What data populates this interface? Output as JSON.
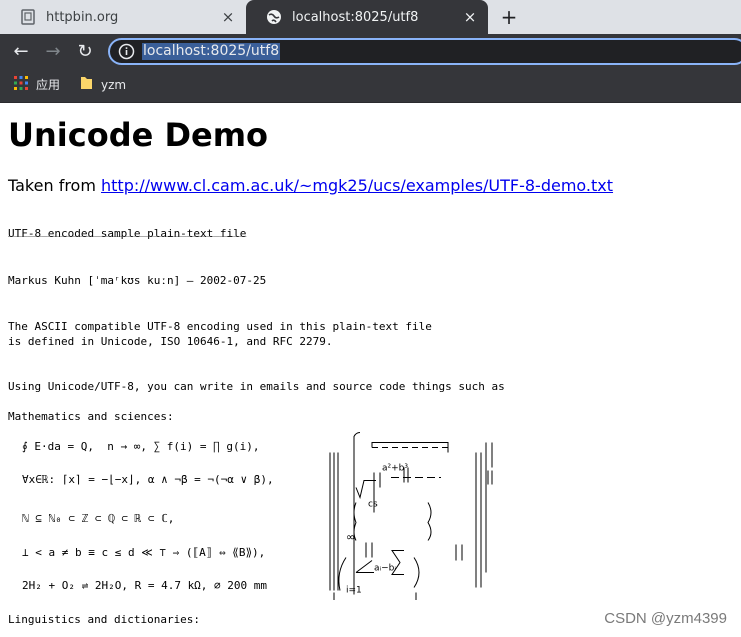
{
  "tabs": [
    {
      "title": "httpbin.org",
      "close": "×"
    },
    {
      "title": "localhost:8025/utf8",
      "close": "×"
    }
  ],
  "new_tab_label": "+",
  "nav": {
    "back": "←",
    "forward": "→",
    "reload": "↻"
  },
  "address_bar": {
    "url": "localhost:8025/utf8"
  },
  "bookmarks": [
    {
      "label": "应用",
      "icon": "apps-grid-icon"
    },
    {
      "label": "yzm",
      "icon": "folder-icon"
    }
  ],
  "page": {
    "title": "Unicode Demo",
    "taken_from_prefix": "Taken from ",
    "link": "http://www.cl.cam.ac.uk/~mgk25/ucs/examples/UTF-8-demo.txt",
    "doc_title": "UTF-8 encoded sample plain-text file",
    "doc_underline": "‾‾‾‾‾‾‾‾‾‾‾‾‾‾‾‾‾‾‾‾‾‾‾‾‾‾‾‾‾‾‾‾‾‾‾‾",
    "author_line": "Markus Kuhn [ˈmaʳkʊs kuːn] — 2002-07-25",
    "intro_line1": "The ASCII compatible UTF-8 encoding used in this plain-text file",
    "intro_line2": "is defined in Unicode, ISO 10646-1, and RFC 2279.",
    "using_line": "Using Unicode/UTF-8, you can write in emails and source code things such as",
    "math_heading": "Mathematics and sciences:",
    "math_lines": [
      "∮ E⋅da = Q,  n → ∞, ∑ f(i) = ∏ g(i),",
      "∀x∈ℝ: ⌈x⌉ = −⌊−x⌋, α ∧ ¬β = ¬(¬α ∨ β),",
      "ℕ ⊆ ℕ₀ ⊂ ℤ ⊂ ℚ ⊂ ℝ ⊂ ℂ,",
      "⊥ < a ≠ b ≡ c ≤ d ≪ ⊤ ⇒ (⟦A⟧ ⇔ ⟪B⟫),",
      "2H₂ + O₂ ⇌ 2H₂O, R = 4.7 kΩ, ⌀ 200 mm"
    ],
    "math_art": {
      "a2b3": "a²+b³",
      "cs": "cs",
      "inf": "∞",
      "ai_bi": "aᵢ−bᵢ",
      "i1": "i=1"
    },
    "linguistics_heading": "Linguistics and dictionaries:"
  },
  "watermark": "CSDN @yzm4399"
}
